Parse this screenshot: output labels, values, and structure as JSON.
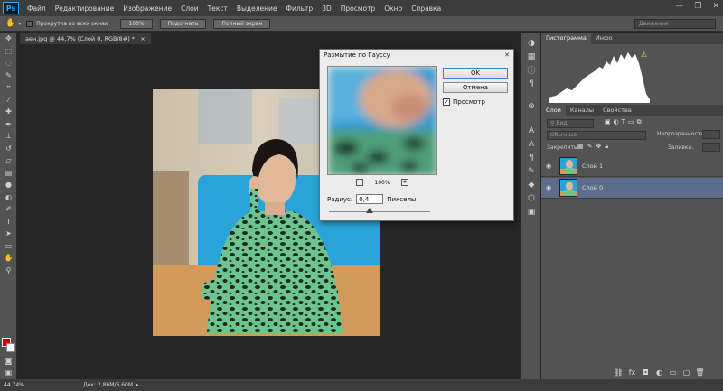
{
  "app": {
    "logo": "Ps"
  },
  "menu": [
    "Файл",
    "Редактирование",
    "Изображение",
    "Слои",
    "Текст",
    "Выделение",
    "Фильтр",
    "3D",
    "Просмотр",
    "Окно",
    "Справка"
  ],
  "window_controls": {
    "minimize": "—",
    "restore": "❐",
    "close": "✕"
  },
  "options_bar": {
    "scroll_all_label": "Прокрутка во всех окнах",
    "zoom_100": "100%",
    "fit": "Подогнать",
    "fullscreen": "Полный экран",
    "workspace": "Движение"
  },
  "document": {
    "tab_title": "аен.jpg @ 44,7% (Слой 0, RGB/8#) *",
    "close": "×"
  },
  "statusbar": {
    "zoom": "44,74%",
    "doc": "Док: 2,86M/6,60M"
  },
  "dialog": {
    "title": "Размытие по Гауссу",
    "ok": "OK",
    "cancel": "Отмена",
    "preview_checked": true,
    "preview_label": "Просмотр",
    "zoom": "100%",
    "zoom_out": "−",
    "zoom_in": "+",
    "radius_label": "Радиус:",
    "radius_value": "0,4",
    "radius_unit": "Пикселы",
    "close": "✕"
  },
  "panels": {
    "top_tabs": [
      "Гистограмма",
      "Инфо"
    ],
    "layer_tabs": [
      "Слои",
      "Каналы",
      "Свойства"
    ],
    "kind_filter": "Вид",
    "blend_mode": "Обычные",
    "opacity_label": "Непрозрачность:",
    "lock_label": "Закрепить:",
    "fill_label": "Заливка:",
    "layers": [
      {
        "name": "Слой 1",
        "selected": false
      },
      {
        "name": "Слой 0",
        "selected": true
      }
    ]
  },
  "colors": {
    "accent_selected_layer": "#5b6d8a",
    "foreground": "#cc0000",
    "background": "#ffffff"
  },
  "icons": {
    "tools": [
      "move-icon",
      "marquee-icon",
      "lasso-icon",
      "quick-select-icon",
      "crop-icon",
      "eyedropper-icon",
      "healing-icon",
      "brush-icon",
      "stamp-icon",
      "history-brush-icon",
      "eraser-icon",
      "gradient-icon",
      "blur-icon",
      "dodge-icon",
      "pen-icon",
      "type-icon",
      "path-select-icon",
      "rectangle-icon",
      "hand-icon",
      "zoom-icon"
    ]
  }
}
